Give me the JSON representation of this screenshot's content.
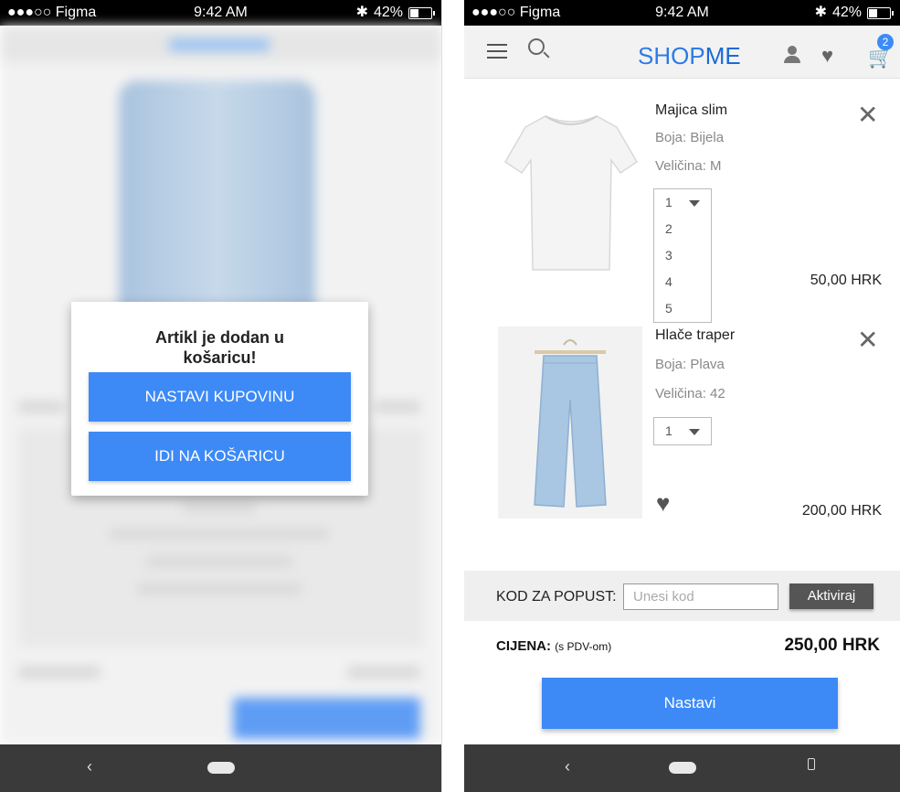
{
  "status": {
    "carrier": "●●●○○ Figma",
    "time": "9:42 AM",
    "battery": "42%",
    "bluetooth": "✱"
  },
  "left": {
    "modal": {
      "title": "Artikl je dodan u košaricu!",
      "continue_label": "NASTAVI KUPOVINU",
      "cart_label": "IDI NA KOŠARICU"
    }
  },
  "right": {
    "logo": {
      "shop": "SHOP",
      "me": "ME"
    },
    "cart_badge": "2",
    "items": [
      {
        "name": "Majica slim",
        "color": "Boja: Bijela",
        "size": "Veličina: M",
        "qty": "1",
        "qty_options": [
          "2",
          "3",
          "4",
          "5"
        ],
        "price": "50,00 HRK"
      },
      {
        "name": "Hlače traper",
        "color": "Boja: Plava",
        "size": "Veličina: 42",
        "qty": "1",
        "price": "200,00 HRK"
      }
    ],
    "discount": {
      "label": "KOD ZA POPUST:",
      "placeholder": "Unesi kod",
      "button": "Aktiviraj"
    },
    "total": {
      "label": "CIJENA:",
      "note": "(s PDV-om)",
      "value": "250,00 HRK"
    },
    "next_label": "Nastavi"
  },
  "icons": [
    "menu-icon",
    "search-icon",
    "user-icon",
    "heart-icon",
    "cart-icon",
    "close-icon",
    "chevron-down-icon",
    "back-icon",
    "home-icon",
    "rotate-icon"
  ],
  "colors": {
    "accent": "#3d8af7",
    "dark_button": "#555555",
    "nav_bar": "#3a3a3a"
  }
}
